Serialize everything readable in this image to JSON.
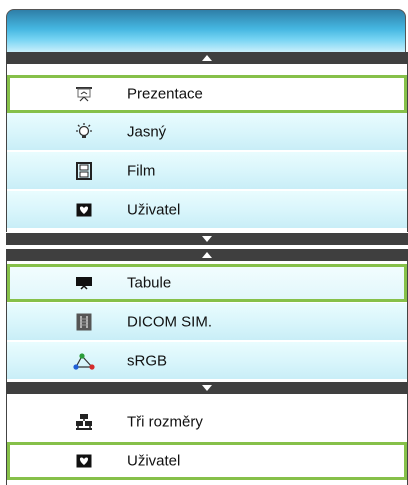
{
  "menu": {
    "group1": [
      {
        "label": "Prezentace",
        "icon": "presentation-icon",
        "selected": true
      },
      {
        "label": "Jasný",
        "icon": "bright-bulb-icon",
        "selected": false
      },
      {
        "label": "Film",
        "icon": "film-icon",
        "selected": false
      },
      {
        "label": "Uživatel",
        "icon": "user-heart-icon",
        "selected": false
      }
    ],
    "group2": [
      {
        "label": "Tabule",
        "icon": "blackboard-icon",
        "selected": true
      },
      {
        "label": "DICOM SIM.",
        "icon": "xray-icon",
        "selected": false
      },
      {
        "label": "sRGB",
        "icon": "srgb-triangle-icon",
        "selected": false
      }
    ],
    "group3": [
      {
        "label": "Tři rozměry",
        "icon": "3d-icon",
        "selected": false
      },
      {
        "label": "Uživatel",
        "icon": "user-heart-icon",
        "selected": true
      }
    ]
  },
  "colors": {
    "selection_border": "#86c049",
    "header_gradient_top": "#2f7fa8",
    "header_gradient_bottom": "#c9effb",
    "arrow_bar": "#3f3f3f"
  }
}
